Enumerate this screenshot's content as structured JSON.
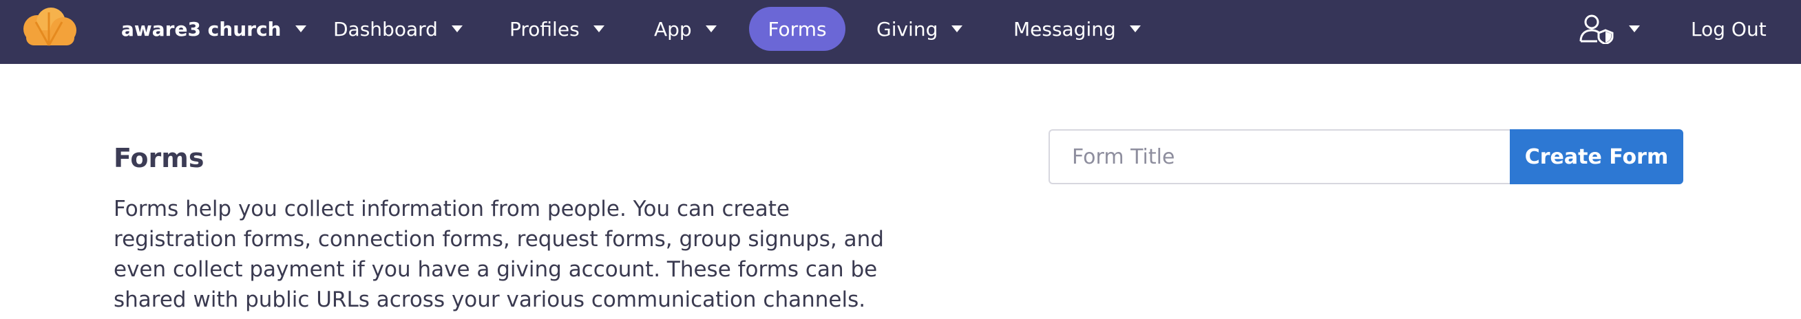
{
  "nav": {
    "church_label": "aware3 church",
    "items": [
      {
        "label": "Dashboard"
      },
      {
        "label": "Profiles"
      },
      {
        "label": "App"
      },
      {
        "label": "Forms",
        "active": true
      },
      {
        "label": "Giving"
      },
      {
        "label": "Messaging"
      }
    ],
    "user_icon": "user-shield-icon",
    "logout_label": "Log Out",
    "colors": {
      "bar": "#363558",
      "active_pill": "#6b67d6",
      "logo": "#f3a23a"
    }
  },
  "main": {
    "title": "Forms",
    "description": "Forms help you collect information from people. You can create registration forms, connection forms, request forms, group signups, and even collect payment if you have a giving account. These forms can be shared with public URLs across your various communication channels.",
    "form_title_input": {
      "placeholder": "Form Title",
      "value": ""
    },
    "create_button_label": "Create Form",
    "colors": {
      "primary_button": "#2d78d3"
    }
  }
}
